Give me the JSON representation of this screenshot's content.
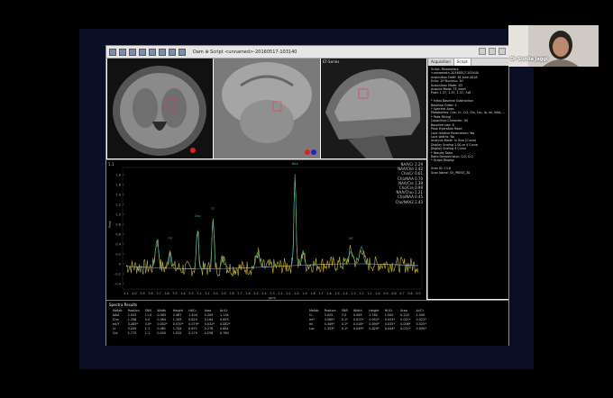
{
  "app": {
    "title": "Dam  ⊕ Script  <unnamed>-20160517-103140",
    "image_labels": [
      "",
      "",
      "ET-Series"
    ],
    "tabs": [
      "Acquisition",
      "Script"
    ],
    "active_tab": "Script"
  },
  "spectrum": {
    "corner": "1.1",
    "legend": [
      "NAA/Cr  2.29",
      "NAA/Cho  1.42",
      "Cho/Cr  0.61",
      "Cho/NAA  0.70",
      "NAA/Cre  1.39",
      "Cho/Cre  0.99",
      "NAA/Cho₂  2.21",
      "Cho/NAA  0.45",
      "Cho/NAA2  2.43"
    ],
    "y_ticks": [
      "1.8",
      "1.6",
      "1.4",
      "1.2",
      "1.0",
      "0.8",
      "0.6",
      "0.4",
      "0.2",
      "0",
      "-0.2",
      "-0.4"
    ],
    "x_ticks": [
      "4.1",
      "4.0",
      "3.9",
      "3.8",
      "3.7",
      "3.6",
      "3.5",
      "3.4",
      "3.3",
      "3.2",
      "3.1",
      "3.0",
      "2.9",
      "2.8",
      "2.7",
      "2.6",
      "2.5",
      "2.4",
      "2.3",
      "2.2",
      "2.1",
      "2.0",
      "1.9",
      "1.8",
      "1.7",
      "1.6",
      "1.5",
      "1.4",
      "1.3",
      "1.2",
      "1.1",
      "1.0",
      "0.9",
      "0.8",
      "0.7",
      "0.6",
      "0.5"
    ],
    "ylabel": "Peak",
    "xlabel": "ppm",
    "peak_labels": [
      "Cho",
      "Cr",
      "mI",
      "NAA",
      "Lac"
    ]
  },
  "side_panel": {
    "lines": [
      "Script: Parameters",
      "<unnamed>-20160517-103440",
      "Acquisition Date: 18-June-2016",
      "Echo: 1H  Nucleus: 1H",
      "Acquisition Mode: 2D",
      "Acquire Mode: TE_short",
      "Pixel: 1.37, 1.37, 1.37, 7x8",
      "",
      "* Initial Baseline Subtraction",
      "  Baseline Order: 4",
      "* Spectral Apex",
      "  Metabolites: Cho, Cr, Cr2, Glx, Lac, Ip, mI, NAA, ...",
      "* Peak Fitting",
      "  Capacitive Character: 90",
      "  Baseline size: 8",
      "  Peak Hydration Read",
      "  Lock relative Parameters: Yes",
      "  Lock widths: No",
      "  Analysis Mode: In Vivo (Curve)",
      "  Display Scaling 2.00 or 4 Curve",
      "  Display Scaling 4 Curve",
      "* Results Table",
      "  Ratio Denominator: Cr2, Cr2",
      "* Graph Display",
      "",
      "  Scan ID: 15.6",
      "  Scan Name: SV_PRESS_30"
    ]
  },
  "results": {
    "title": "Spectra Results",
    "left": {
      "headers": [
        "Metab",
        "Position",
        "SNR",
        "Width",
        "Height",
        "Ht/Cr",
        "Area",
        "Ar/Cr"
      ],
      "rows": [
        [
          "NAA",
          "2.042",
          "11.0",
          "0.083",
          "2.487",
          "1.404",
          "0.309",
          "1.134"
        ],
        [
          "Cho",
          "1.298",
          "5.0",
          "0.064",
          "1.109",
          "0.620",
          "0.184",
          "0.655"
        ],
        [
          "mI/Y",
          "3.283*",
          "3.0*",
          "0.052*",
          "0.070*",
          "0.079*",
          "0.032*",
          "0.082*"
        ],
        [
          "Cr",
          "3.209",
          "1.1",
          "0.061",
          "1.754",
          "0.671",
          "0.278",
          "0.881"
        ],
        [
          "Glx",
          "2.775",
          "1.1",
          "0.050",
          "1.025",
          "0.279",
          "0.258",
          "0.760"
        ]
      ]
    },
    "right": {
      "headers": [
        "Metab",
        "Position",
        "SNR",
        "Width",
        "Height",
        "Ht/Cr",
        "Area",
        "Ar/Cr"
      ],
      "rows": [
        [
          "Cr",
          "3.025",
          "7.0",
          "0.063",
          "1.782",
          "1.000",
          "0.225",
          "1.000"
        ],
        [
          "mI*",
          "3.560*",
          "0.1*",
          "0.012*",
          "0.952*",
          "0.053*",
          "0.011*",
          "0.021*"
        ],
        [
          "mI",
          "4.349*",
          "0.1*",
          "0.018*",
          "0.890*",
          "0.035*",
          "0.006*",
          "0.025*"
        ],
        [
          "Lac",
          "1.323*",
          "0.1*",
          "0.049*",
          "0.820*",
          "0.044*",
          "0.011*",
          "0.050*"
        ]
      ]
    }
  },
  "webcam": {
    "name": "Dr Sunila Jaggi"
  }
}
